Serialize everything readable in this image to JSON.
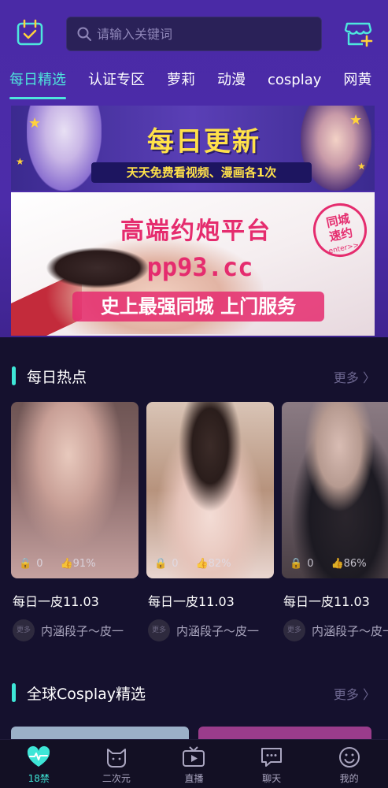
{
  "header": {
    "search_placeholder": "请输入关键词"
  },
  "tabs": [
    {
      "label": "每日精选",
      "active": true
    },
    {
      "label": "认证专区"
    },
    {
      "label": "萝莉"
    },
    {
      "label": "动漫"
    },
    {
      "label": "cosplay"
    },
    {
      "label": "网黄"
    }
  ],
  "banner_daily": {
    "title": "每日更新",
    "subtitle": "天天免费看视频、漫画各1次"
  },
  "banner_ad": {
    "title": "高端约炮平台",
    "url": "pp93.cc",
    "subtitle": "史上最强同城 上门服务",
    "badge": "同城\n速约",
    "badge_small": "enter>>"
  },
  "section_hot": {
    "title": "每日热点",
    "more": "更多 〉"
  },
  "cards": [
    {
      "likes": "0",
      "percent": "91%",
      "title": "每日一皮11.03",
      "avatar_text": "更多",
      "author": "内涵段子～皮一",
      "img_colors": [
        "#d9b8b0",
        "#8a6a6a",
        "#c6a2a0"
      ]
    },
    {
      "likes": "0",
      "percent": "82%",
      "title": "每日一皮11.03",
      "avatar_text": "更多",
      "author": "内涵段子～皮一",
      "img_colors": [
        "#e9d6d0",
        "#4b3a34",
        "#f3d6cf"
      ]
    },
    {
      "likes": "0",
      "percent": "86%",
      "title": "每日一皮11.03",
      "avatar_text": "更多",
      "author": "内涵段子～皮一",
      "img_colors": [
        "#6c5e66",
        "#1c1a22",
        "#d1b8b1"
      ]
    }
  ],
  "section_cosplay": {
    "title": "全球Cosplay精选",
    "more": "更多 〉"
  },
  "bottom_nav": [
    {
      "label": "18禁",
      "icon": "heartbeat-icon",
      "active": true
    },
    {
      "label": "二次元",
      "icon": "cat-icon"
    },
    {
      "label": "直播",
      "icon": "tv-play-icon"
    },
    {
      "label": "聊天",
      "icon": "chat-icon"
    },
    {
      "label": "我的",
      "icon": "smile-icon"
    }
  ],
  "colors": {
    "accent": "#3ee6d7",
    "header_bg": "#4a2aa6",
    "page_bg": "#15112e"
  }
}
